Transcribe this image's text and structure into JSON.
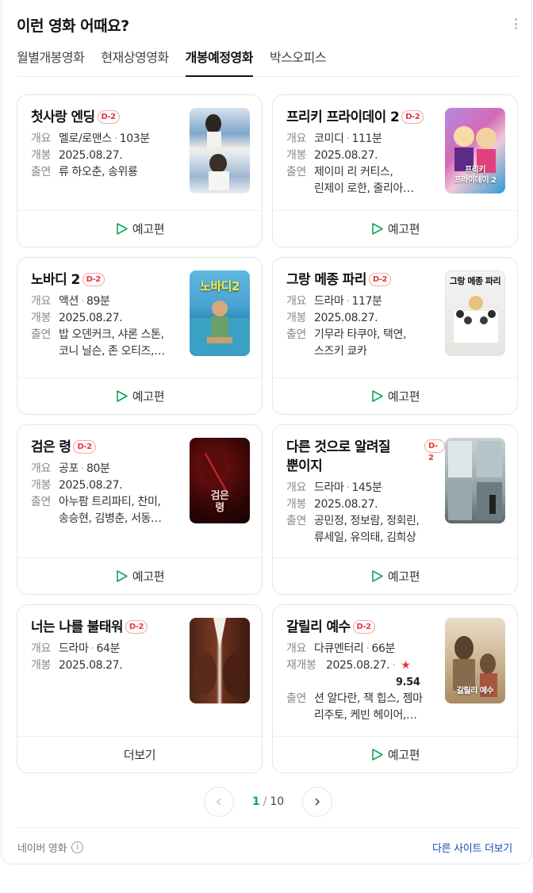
{
  "header": {
    "title": "이런 영화 어때요?"
  },
  "tabs": [
    {
      "label": "월별개봉영화"
    },
    {
      "label": "현재상영영화"
    },
    {
      "label": "개봉예정영화"
    },
    {
      "label": "박스오피스"
    }
  ],
  "labels": {
    "genre": "개요",
    "open": "개봉",
    "reopen": "재개봉",
    "cast": "출연",
    "trailer": "예고편",
    "more": "더보기"
  },
  "movies": [
    {
      "title": "첫사랑 엔딩",
      "badge": "D-2",
      "genre": "멜로/로맨스",
      "runtime": "103분",
      "date": "2025.08.27.",
      "cast1": "류 하오춘, 송위룡",
      "cast2": ""
    },
    {
      "title": "프리키 프라이데이 2",
      "badge": "D-2",
      "genre": "코미디",
      "runtime": "111분",
      "date": "2025.08.27.",
      "cast1": "제이미 리 커티스,",
      "cast2": "린제이 로한, 줄리아…",
      "poster_text": "프리키\n프라이데이 2"
    },
    {
      "title": "노바디 2",
      "badge": "D-2",
      "genre": "액션",
      "runtime": "89분",
      "date": "2025.08.27.",
      "cast1": "밥 오덴커크, 샤론 스톤,",
      "cast2": "코니 닐슨, 존 오티즈,…",
      "poster_text": "노바디2"
    },
    {
      "title": "그랑 메종 파리",
      "badge": "D-2",
      "genre": "드라마",
      "runtime": "117분",
      "date": "2025.08.27.",
      "cast1": "기무라 타쿠야, 택연,",
      "cast2": "스즈키 쿄카",
      "poster_text": "그랑 메종 파리"
    },
    {
      "title": "검은 령",
      "badge": "D-2",
      "genre": "공포",
      "runtime": "80분",
      "date": "2025.08.27.",
      "cast1": "아누팜 트리파티, 찬미,",
      "cast2": "송승현, 김병춘, 서동…",
      "poster_text": "검은\n령"
    },
    {
      "title": "다른 것으로 알려질 뿐이지",
      "badge": "D-2",
      "genre": "드라마",
      "runtime": "145분",
      "date": "2025.08.27.",
      "cast1": "공민정, 정보람, 정회린,",
      "cast2": "류세일, 유의태, 김희상"
    },
    {
      "title": "너는 나를 불태워",
      "badge": "D-2",
      "genre": "드라마",
      "runtime": "64분",
      "date": "2025.08.27."
    },
    {
      "title": "갈릴리 예수",
      "badge": "D-2",
      "genre": "다큐멘터리",
      "runtime": "66분",
      "date": "2025.08.27.",
      "rating": "9.54",
      "cast1": "션 알다란, 잭 힙스, 젬마",
      "cast2": "리주토, 케빈 헤이어,…",
      "poster_text": "갈릴리 예수"
    }
  ],
  "pager": {
    "current": "1",
    "separator": "/",
    "total": "10"
  },
  "footer": {
    "source": "네이버 영화",
    "info": "i",
    "more_sites": "다른 사이트 더보기"
  },
  "colors": {
    "accent_green": "#0ea65b",
    "badge_red": "#e5383b",
    "link_blue": "#1a4fb3"
  }
}
